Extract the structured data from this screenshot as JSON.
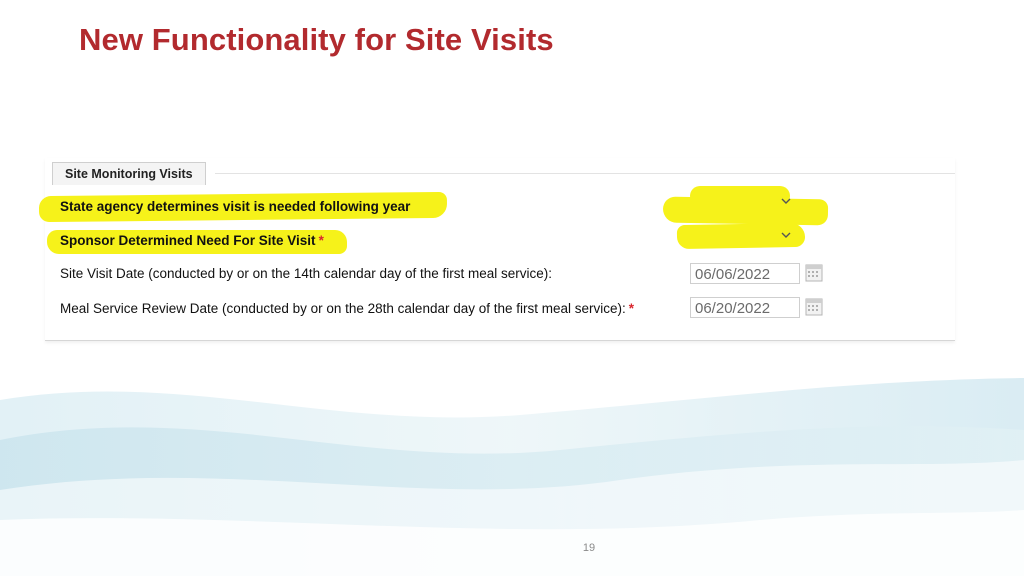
{
  "slide": {
    "title": "New Functionality for Site Visits",
    "page_number": "19"
  },
  "form": {
    "section_tab": "Site Monitoring Visits",
    "rows": [
      {
        "label": "State agency determines visit is needed following year",
        "required": false,
        "control": "select",
        "value": ""
      },
      {
        "label": "Sponsor Determined Need For Site Visit",
        "required": true,
        "control": "select",
        "value": ""
      },
      {
        "label": "Site Visit Date (conducted by or on the 14th calendar day of the first meal service):",
        "required": false,
        "control": "date",
        "value": "06/06/2022"
      },
      {
        "label": "Meal Service Review Date (conducted by or on the 28th calendar day of the first meal service):",
        "required": true,
        "control": "date",
        "value": "06/20/2022"
      }
    ],
    "required_marker": "*"
  },
  "icons": {
    "dropdown": "chevron-down-icon",
    "calendar": "calendar-icon"
  },
  "colors": {
    "title": "#b22a2e",
    "highlight": "#f6f21a",
    "required": "#d9262d",
    "wave": "#cfe8f0"
  }
}
